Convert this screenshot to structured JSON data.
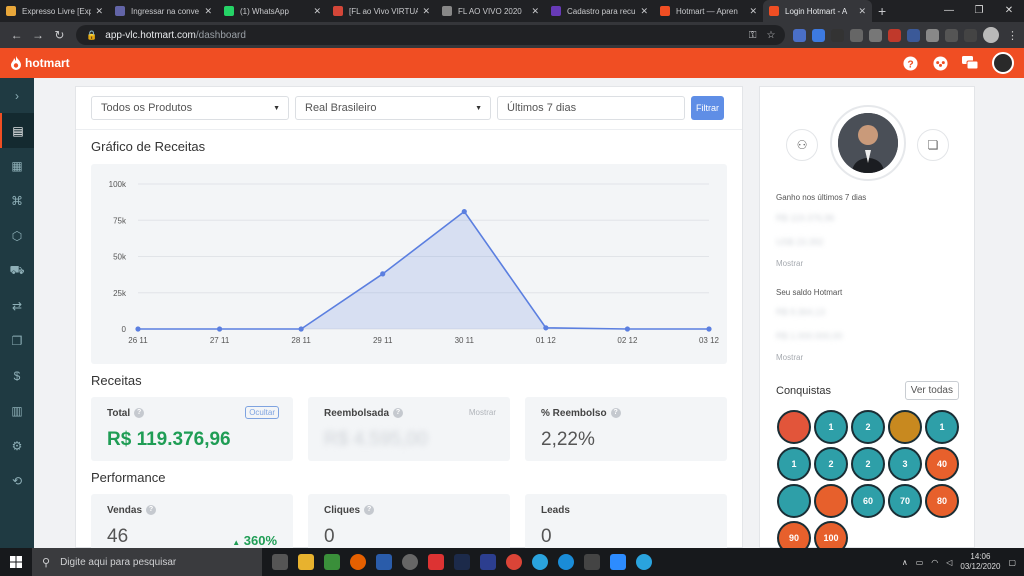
{
  "browser": {
    "tabs": [
      {
        "title": "Expresso Livre [Exp",
        "color": "#e8a73a"
      },
      {
        "title": "Ingressar na conve",
        "color": "#6264a7"
      },
      {
        "title": "(1) WhatsApp",
        "color": "#25d366"
      },
      {
        "title": "[FL ao Vivo VIRTUA",
        "color": "#d44638"
      },
      {
        "title": "FL AO VIVO 2020",
        "color": "#888888"
      },
      {
        "title": "Cadastro para recu",
        "color": "#673ab7"
      },
      {
        "title": "Hotmart — Apren",
        "color": "#f04e23"
      },
      {
        "title": "Login Hotmart - A",
        "color": "#f04e23"
      }
    ],
    "new_tab": "+",
    "url_host": "app-vlc.hotmart.com",
    "url_path": "/dashboard"
  },
  "header": {
    "logo": "hotmart"
  },
  "filters": {
    "product": "Todos os Produtos",
    "currency": "Real Brasileiro",
    "period": "Últimos 7 dias",
    "button": "Filtrar"
  },
  "sections": {
    "chart_title": "Gráfico de Receitas",
    "revenue_title": "Receitas",
    "performance_title": "Performance"
  },
  "chart_data": {
    "type": "area",
    "title": "Gráfico de Receitas",
    "categories": [
      "26 11",
      "27 11",
      "28 11",
      "29 11",
      "30 11",
      "01 12",
      "02 12",
      "03 12"
    ],
    "values": [
      0,
      0,
      0,
      38000,
      81000,
      800,
      0,
      0
    ],
    "y_ticks": [
      "0",
      "25k",
      "50k",
      "75k",
      "100k"
    ],
    "ylim": [
      0,
      100000
    ],
    "grid": true,
    "color": "#5b7fe0"
  },
  "receitas": {
    "total_label": "Total",
    "total_value": "R$ 119.376,96",
    "total_toggle": "Ocultar",
    "refunded_label": "Reembolsada",
    "refunded_value": "R$ 4.595,00",
    "refunded_toggle": "Mostrar",
    "refund_pct_label": "% Reembolso",
    "refund_pct_value": "2,22%"
  },
  "performance": {
    "sales_label": "Vendas",
    "sales_value": "46",
    "sales_growth": "360%",
    "clicks_label": "Cliques",
    "clicks_value": "0",
    "leads_label": "Leads",
    "leads_value": "0"
  },
  "profile": {
    "earned_label": "Ganho nos últimos 7 dias",
    "earned_line1": "R$ 119.376,96",
    "earned_line2": "US$ 23.392",
    "show1": "Mostrar",
    "balance_label": "Seu saldo Hotmart",
    "balance_line1": "R$ 9.364,13",
    "balance_line2": "R$ 1.000.000,00",
    "show2": "Mostrar",
    "conquistas": "Conquistas",
    "ver_todas": "Ver todas",
    "badges": [
      {
        "label": "",
        "color": "#e2553a"
      },
      {
        "label": "1",
        "color": "#2e9fa8"
      },
      {
        "label": "2",
        "color": "#2e9fa8"
      },
      {
        "label": "",
        "color": "#c8891f"
      },
      {
        "label": "1",
        "color": "#2e9fa8"
      },
      {
        "label": "1",
        "color": "#2e9fa8"
      },
      {
        "label": "2",
        "color": "#2e9fa8"
      },
      {
        "label": "2",
        "color": "#2e9fa8"
      },
      {
        "label": "3",
        "color": "#2e9fa8"
      },
      {
        "label": "40",
        "color": "#e7602c"
      },
      {
        "label": "",
        "color": "#2e9fa8"
      },
      {
        "label": "",
        "color": "#e7602c"
      },
      {
        "label": "60",
        "color": "#2e9fa8"
      },
      {
        "label": "70",
        "color": "#2e9fa8"
      },
      {
        "label": "80",
        "color": "#e7602c"
      },
      {
        "label": "90",
        "color": "#e7602c"
      },
      {
        "label": "100",
        "color": "#e7602c"
      }
    ]
  },
  "taskbar": {
    "search": "Digite aqui para pesquisar",
    "time": "14:06",
    "date": "03/12/2020"
  }
}
